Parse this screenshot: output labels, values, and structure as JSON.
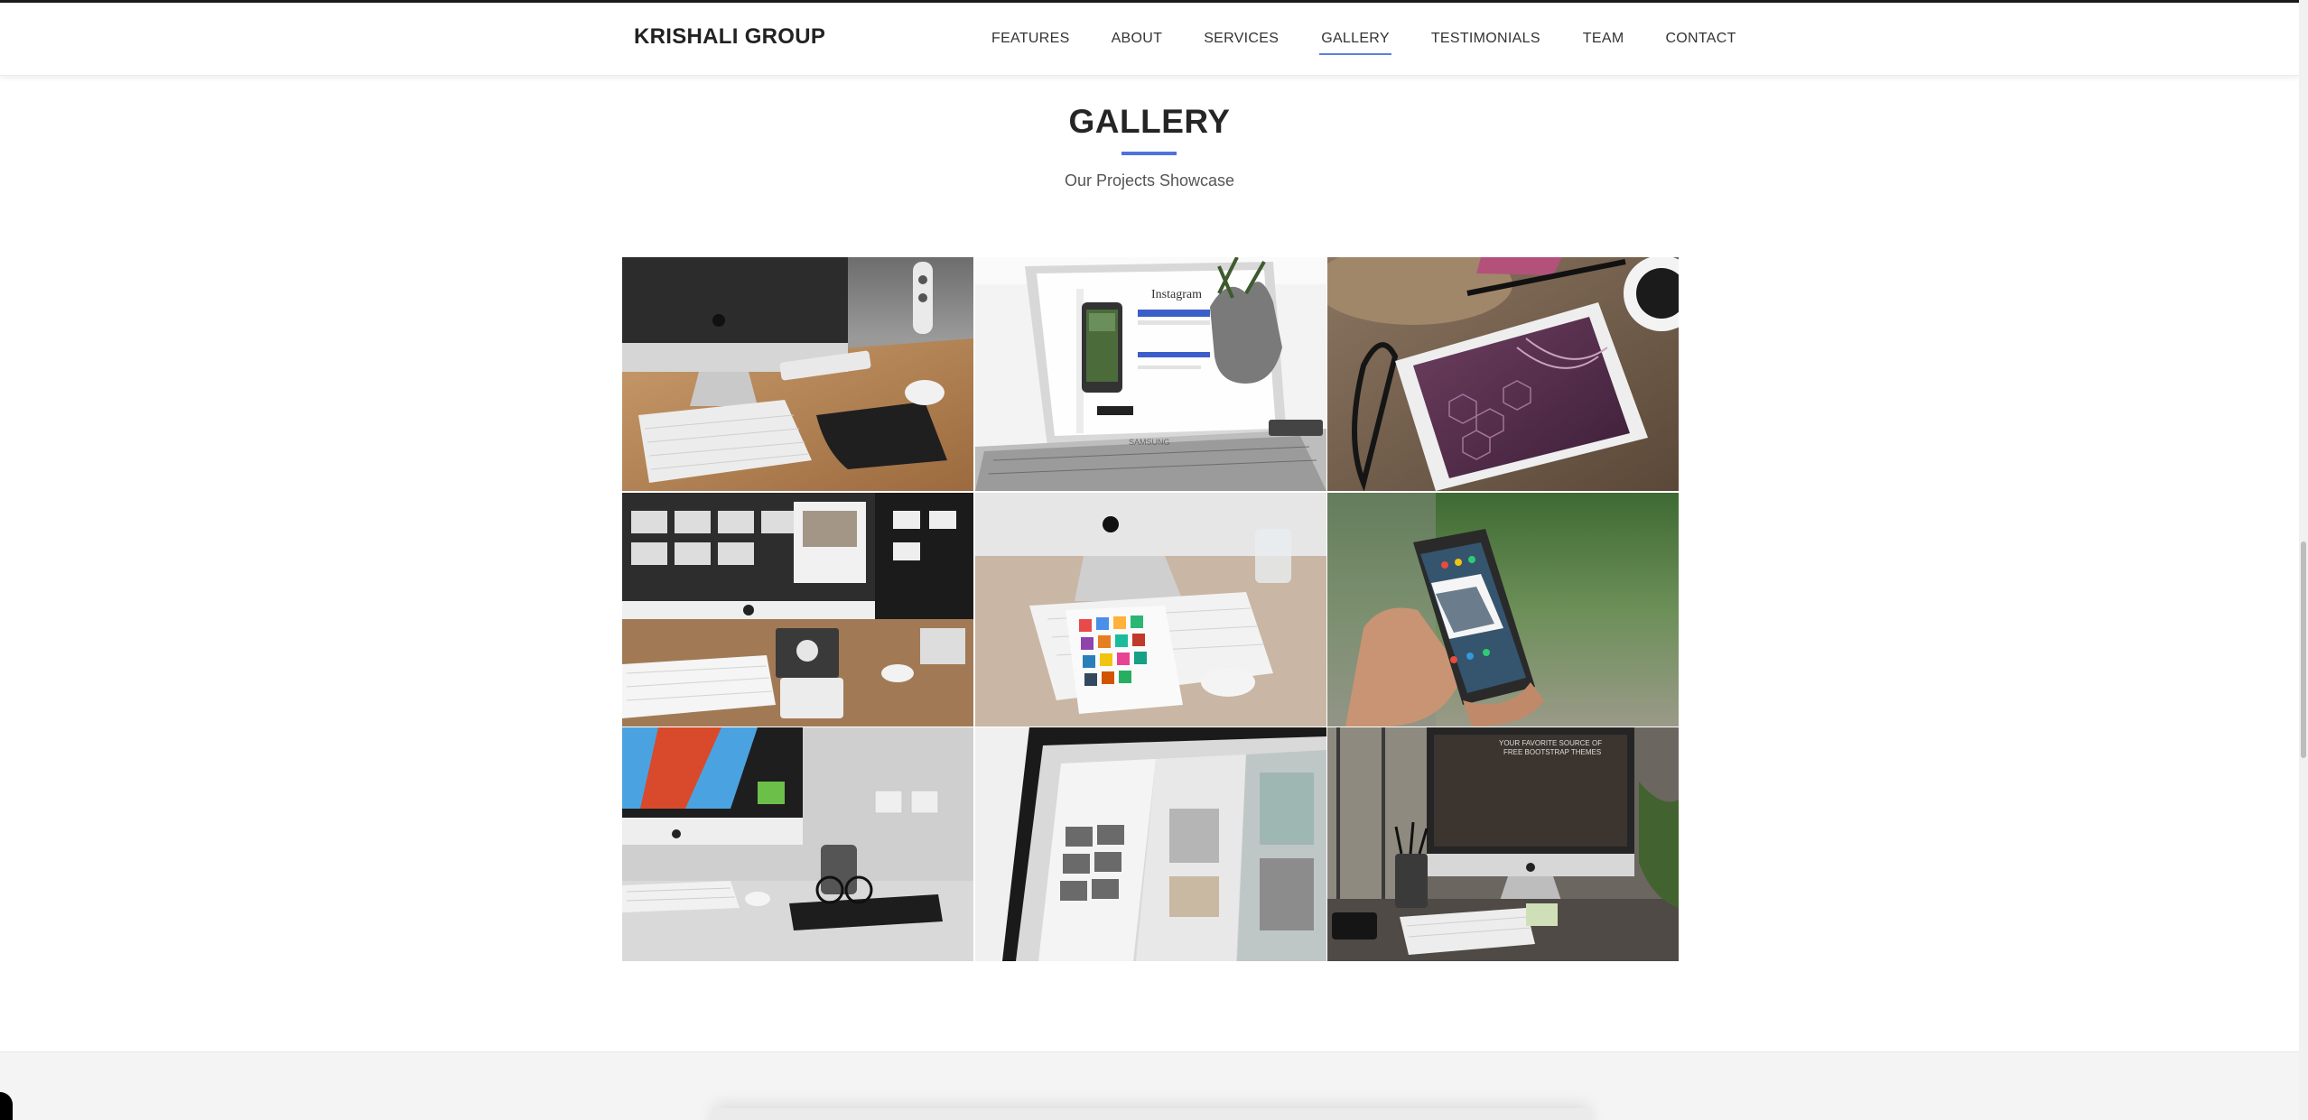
{
  "header": {
    "brand": "KRISHALI GROUP",
    "nav": [
      {
        "label": "FEATURES"
      },
      {
        "label": "ABOUT"
      },
      {
        "label": "SERVICES"
      },
      {
        "label": "GALLERY",
        "active": true
      },
      {
        "label": "TESTIMONIALS"
      },
      {
        "label": "TEAM"
      },
      {
        "label": "CONTACT"
      }
    ],
    "accent_color": "#4f73dc"
  },
  "gallery": {
    "title": "GALLERY",
    "subtitle": "Our Projects Showcase",
    "images": [
      {
        "subject": "imac-desk-keyboard-mouse"
      },
      {
        "subject": "laptop-instagram-phone-plant"
      },
      {
        "subject": "tablet-glasses-pen-coffee"
      },
      {
        "subject": "imac-notebook-keyboard-trackpad"
      },
      {
        "subject": "imac-tablet-app-grid-glass"
      },
      {
        "subject": "hand-holding-android-phone"
      },
      {
        "subject": "imac-red-screen-glasses-mug"
      },
      {
        "subject": "monitor-web-layout-closeup"
      },
      {
        "subject": "imac-window-pen-cup-keyboard"
      }
    ]
  },
  "scrollbar": {
    "position": 0.55
  }
}
